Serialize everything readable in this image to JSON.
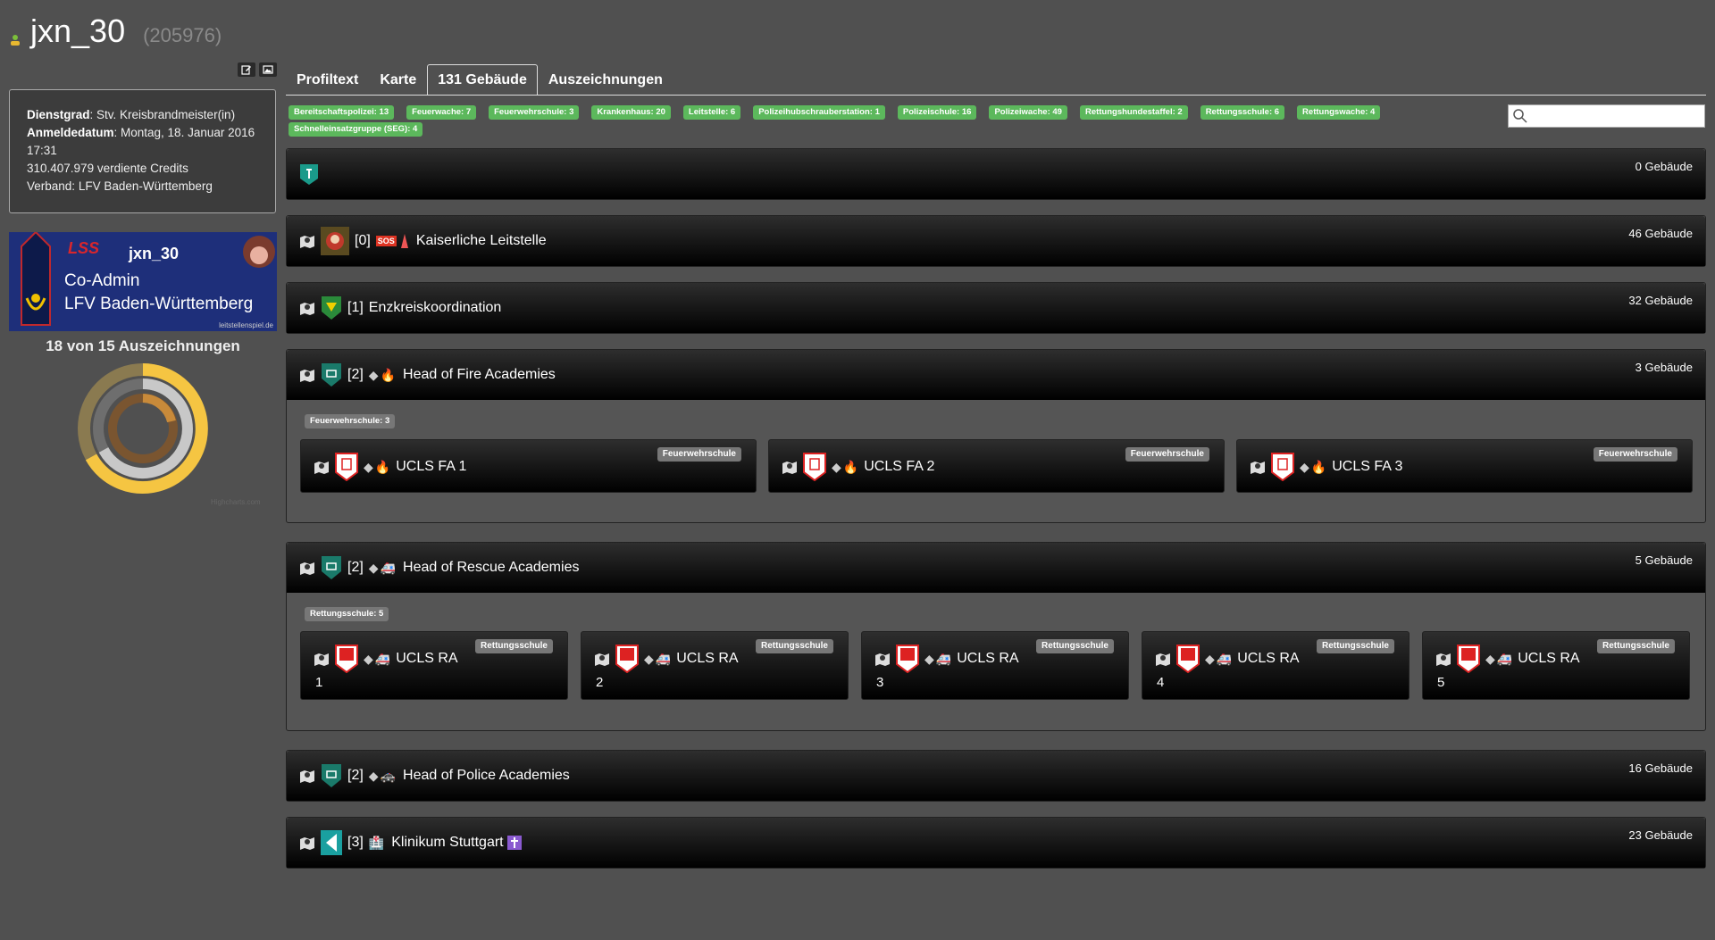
{
  "profile": {
    "username": "jxn_30",
    "user_id": "(205976)"
  },
  "info": {
    "rank_label": "Dienstgrad",
    "rank_value": ": Stv. Kreisbrandmeister(in)",
    "signup_label": "Anmeldedatum",
    "signup_value": ": Montag, 18. Januar 2016 17:31",
    "credits": "310.407.979 verdiente Credits",
    "alliance_label": "Verband:",
    "alliance_value": "LFV Baden-Württemberg"
  },
  "banner": {
    "name": "jxn_30",
    "role": "Co-Admin",
    "alliance": "LFV Baden-Württemberg",
    "site": "leitstellenspiel.de",
    "logo": "LSS"
  },
  "awards": {
    "title": "18 von 15 Auszeichnungen",
    "chart_credit": "Highcharts.com"
  },
  "tabs": [
    {
      "label": "Profiltext"
    },
    {
      "label": "Karte"
    },
    {
      "label": "131 Gebäude",
      "active": true
    },
    {
      "label": "Auszeichnungen"
    }
  ],
  "building_labels": [
    "Bereitschaftspolizei: 13",
    "Feuerwache: 7",
    "Feuerwehrschule: 3",
    "Krankenhaus: 20",
    "Leitstelle: 6",
    "Polizeihubschrauberstation: 1",
    "Polizeischule: 16",
    "Polizeiwache: 49",
    "Rettungshundestaffel: 2",
    "Rettungsschule: 6",
    "Rettungswache: 4",
    "Schnelleinsatzgruppe (SEG): 4"
  ],
  "search": {
    "placeholder": ""
  },
  "panels": [
    {
      "title": "",
      "count": "0 Gebäude"
    },
    {
      "prefix": "[0]",
      "title": "Kaiserliche Leitstelle",
      "count": "46 Gebäude"
    },
    {
      "prefix": "[1]",
      "title": "Enzkreiskoordination",
      "count": "32 Gebäude"
    },
    {
      "prefix": "[2]",
      "title": "Head of Fire Academies",
      "count": "3 Gebäude",
      "group_label": "Feuerwehrschule: 3"
    },
    {
      "prefix": "[2]",
      "title": "Head of Rescue Academies",
      "count": "5 Gebäude",
      "group_label": "Rettungsschule: 5"
    },
    {
      "prefix": "[2]",
      "title": "Head of Police Academies",
      "count": "16 Gebäude"
    },
    {
      "prefix": "[3]",
      "title": "Klinikum Stuttgart",
      "count": "23 Gebäude"
    }
  ],
  "fire_schools": [
    {
      "name": "UCLS FA 1",
      "type": "Feuerwehrschule"
    },
    {
      "name": "UCLS FA 2",
      "type": "Feuerwehrschule"
    },
    {
      "name": "UCLS FA 3",
      "type": "Feuerwehrschule"
    }
  ],
  "rescue_schools": [
    {
      "name": "UCLS RA",
      "number": "1",
      "type": "Rettungsschule"
    },
    {
      "name": "UCLS RA",
      "number": "2",
      "type": "Rettungsschule"
    },
    {
      "name": "UCLS RA",
      "number": "3",
      "type": "Rettungsschule"
    },
    {
      "name": "UCLS RA",
      "number": "4",
      "type": "Rettungsschule"
    },
    {
      "name": "UCLS RA",
      "number": "5",
      "type": "Rettungsschule"
    }
  ],
  "icons": {
    "map": "map-marker-icon",
    "sos": "SOS",
    "fire": "🔥",
    "ambulance": "🚑",
    "police": "🚓",
    "hospital": "🏥"
  },
  "colors": {
    "label_green": "#5cb85c",
    "banner_blue": "#1e2f7a",
    "donut_yellow": "#f5c542",
    "donut_orange": "#c88a3a"
  }
}
